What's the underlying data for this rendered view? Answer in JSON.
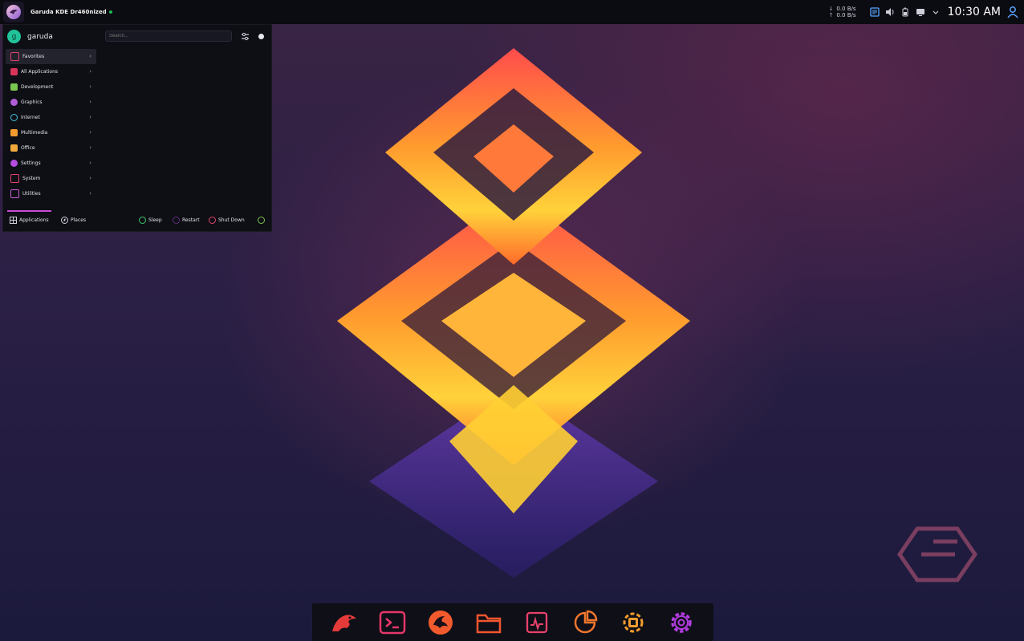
{
  "top_panel": {
    "window_title": "Garuda KDE Dr460nized",
    "net": {
      "down": "0.0 B/s",
      "up": "0.0 B/s"
    },
    "clock": "10:30 AM",
    "tray_icons": [
      "clipboard-icon",
      "volume-icon",
      "battery-icon",
      "display-icon",
      "chevron-down-icon",
      "user-icon"
    ]
  },
  "launcher": {
    "username": "garuda",
    "avatar_letter": "g",
    "search_placeholder": "Search...",
    "categories": [
      {
        "label": "Favorites",
        "color": "#e0446a"
      },
      {
        "label": "All Applications",
        "color": "#d9355b"
      },
      {
        "label": "Development",
        "color": "#7ac74f"
      },
      {
        "label": "Graphics",
        "color": "#b05cd6"
      },
      {
        "label": "Internet",
        "color": "#3fc3d8"
      },
      {
        "label": "Multimedia",
        "color": "#f29b2e"
      },
      {
        "label": "Office",
        "color": "#f2a93b"
      },
      {
        "label": "Settings",
        "color": "#b44de0"
      },
      {
        "label": "System",
        "color": "#e0446a"
      },
      {
        "label": "Utilities",
        "color": "#c85cd6"
      }
    ],
    "tabs": {
      "applications": "Applications",
      "places": "Places"
    },
    "power": {
      "sleep": "Sleep",
      "restart": "Restart",
      "shutdown": "Shut Down"
    }
  },
  "dock": {
    "items": [
      "garuda-eagle-icon",
      "terminal-icon",
      "dragon-icon",
      "folder-icon",
      "system-monitor-icon",
      "disk-usage-icon",
      "garuda-settings-icon",
      "settings-gear-icon"
    ]
  }
}
